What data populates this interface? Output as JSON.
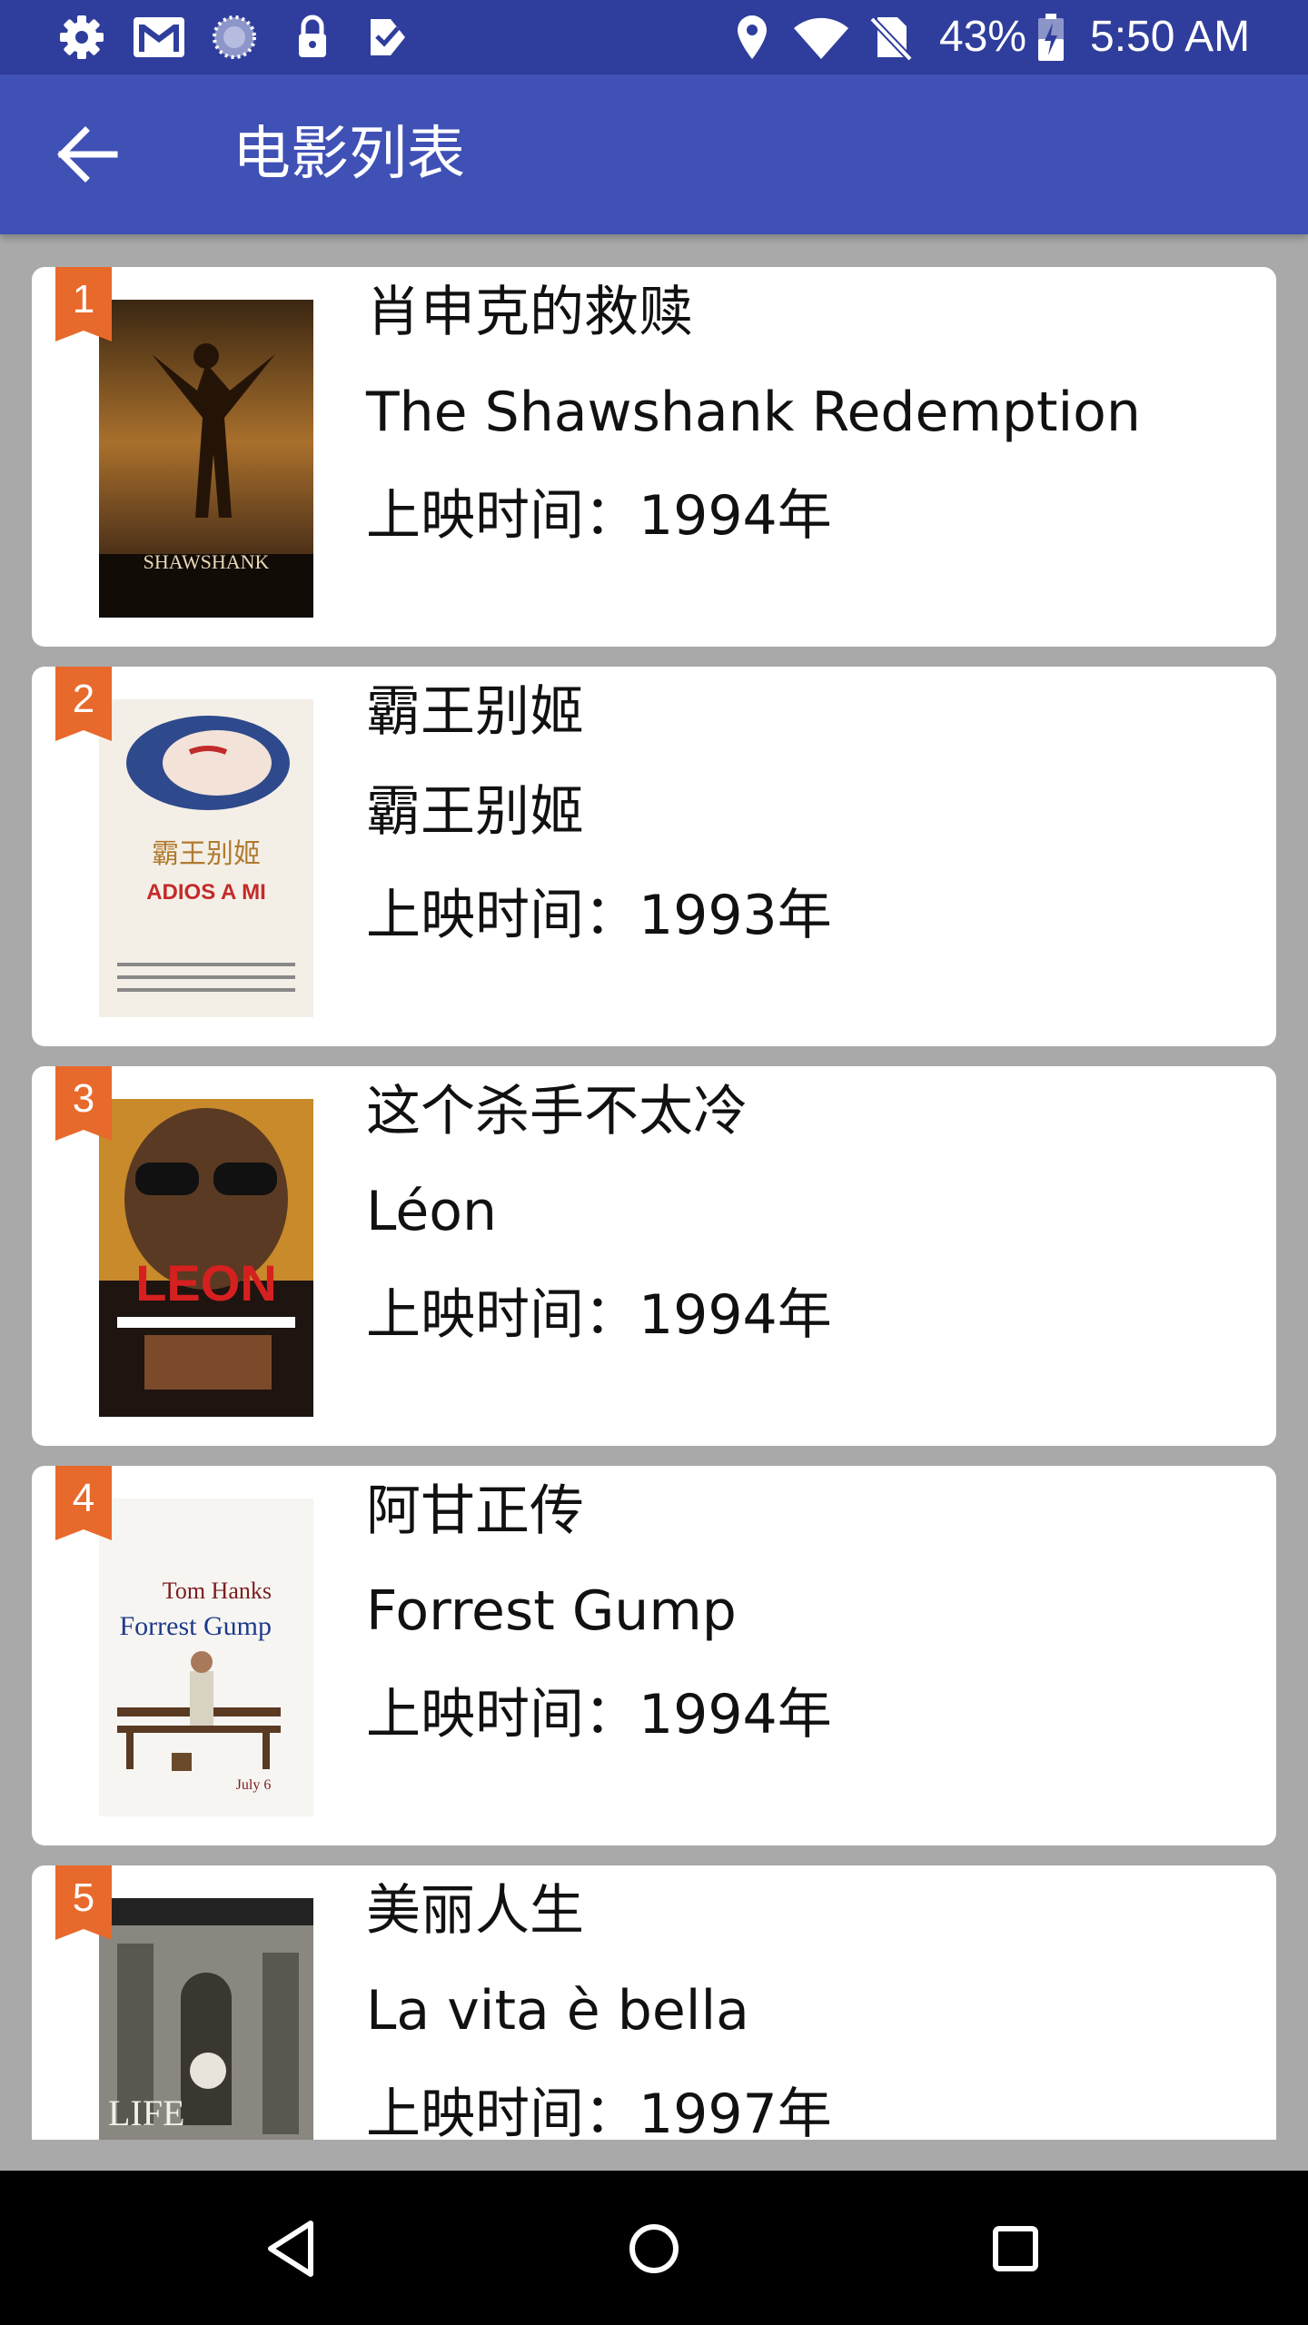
{
  "status_bar": {
    "battery": "43%",
    "time": "5:50 AM",
    "icons": [
      "gear-icon",
      "gmail-icon",
      "sync-icon",
      "lock-icon",
      "task-icon",
      "location-icon",
      "wifi-icon",
      "no-sim-icon",
      "battery-icon"
    ]
  },
  "app_bar": {
    "title": "电影列表",
    "back_icon": "arrow-left-icon",
    "color": "#3f51b5"
  },
  "movies": [
    {
      "rank": "1",
      "title": "肖申克的救赎",
      "original_title": "The Shawshank Redemption",
      "release": "上映时间：1994年",
      "poster_text": "SHAWSHANK"
    },
    {
      "rank": "2",
      "title": "霸王别姬",
      "original_title": "霸王别姬",
      "release": "上映时间：1993年",
      "poster_text": "ADIOS A MI"
    },
    {
      "rank": "3",
      "title": "这个杀手不太冷",
      "original_title": "Léon",
      "release": "上映时间：1994年",
      "poster_text": "LEON"
    },
    {
      "rank": "4",
      "title": "阿甘正传",
      "original_title": "Forrest Gump",
      "release": "上映时间：1994年",
      "poster_text": "Forrest Gump"
    },
    {
      "rank": "5",
      "title": "美丽人生",
      "original_title": "La vita è bella",
      "release": "上映时间：1997年",
      "poster_text": "LIFE"
    }
  ],
  "rank_flag_color": "#e8692c",
  "nav_bar": {
    "icons": [
      "back-triangle-icon",
      "home-circle-icon",
      "recents-square-icon"
    ]
  }
}
